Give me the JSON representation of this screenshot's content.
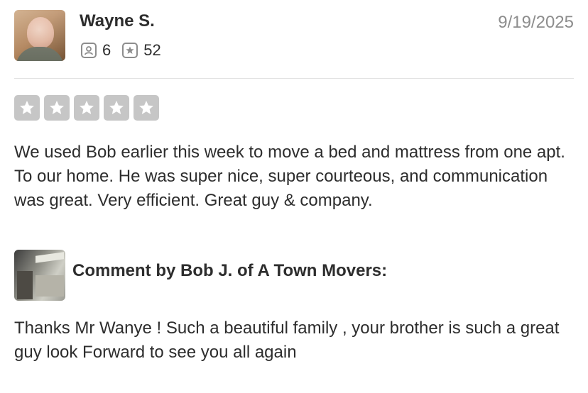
{
  "review": {
    "user_name": "Wayne S.",
    "stats": [
      {
        "icon": "friends-icon",
        "value": "6"
      },
      {
        "icon": "reviews-star-icon",
        "value": "52"
      }
    ],
    "date": "9/19/2025",
    "rating": 5,
    "rating_color": "#c6c6c6",
    "text": "We used Bob earlier this week to move a bed and mattress from one apt. To our home. He was super nice, super courteous, and communication was great. Very efficient. Great guy & company."
  },
  "owner_comment": {
    "heading": "Comment by Bob J. of A Town Movers:",
    "text": "Thanks Mr Wanye ! Such a beautiful family , your brother is such a great guy look Forward to see you all again"
  }
}
